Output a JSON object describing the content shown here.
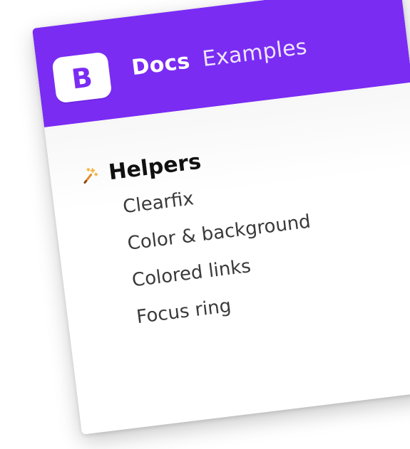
{
  "brand": {
    "logo_letter": "B",
    "accent": "#7a2cf3"
  },
  "nav": {
    "items": [
      {
        "label": "Docs",
        "active": true
      },
      {
        "label": "Examples",
        "active": false
      }
    ]
  },
  "sidebar": {
    "section": {
      "title": "Helpers",
      "icon": "magic-wand-icon",
      "items": [
        {
          "label": "Clearfix"
        },
        {
          "label": "Color & background"
        },
        {
          "label": "Colored links"
        },
        {
          "label": "Focus ring"
        }
      ]
    }
  }
}
